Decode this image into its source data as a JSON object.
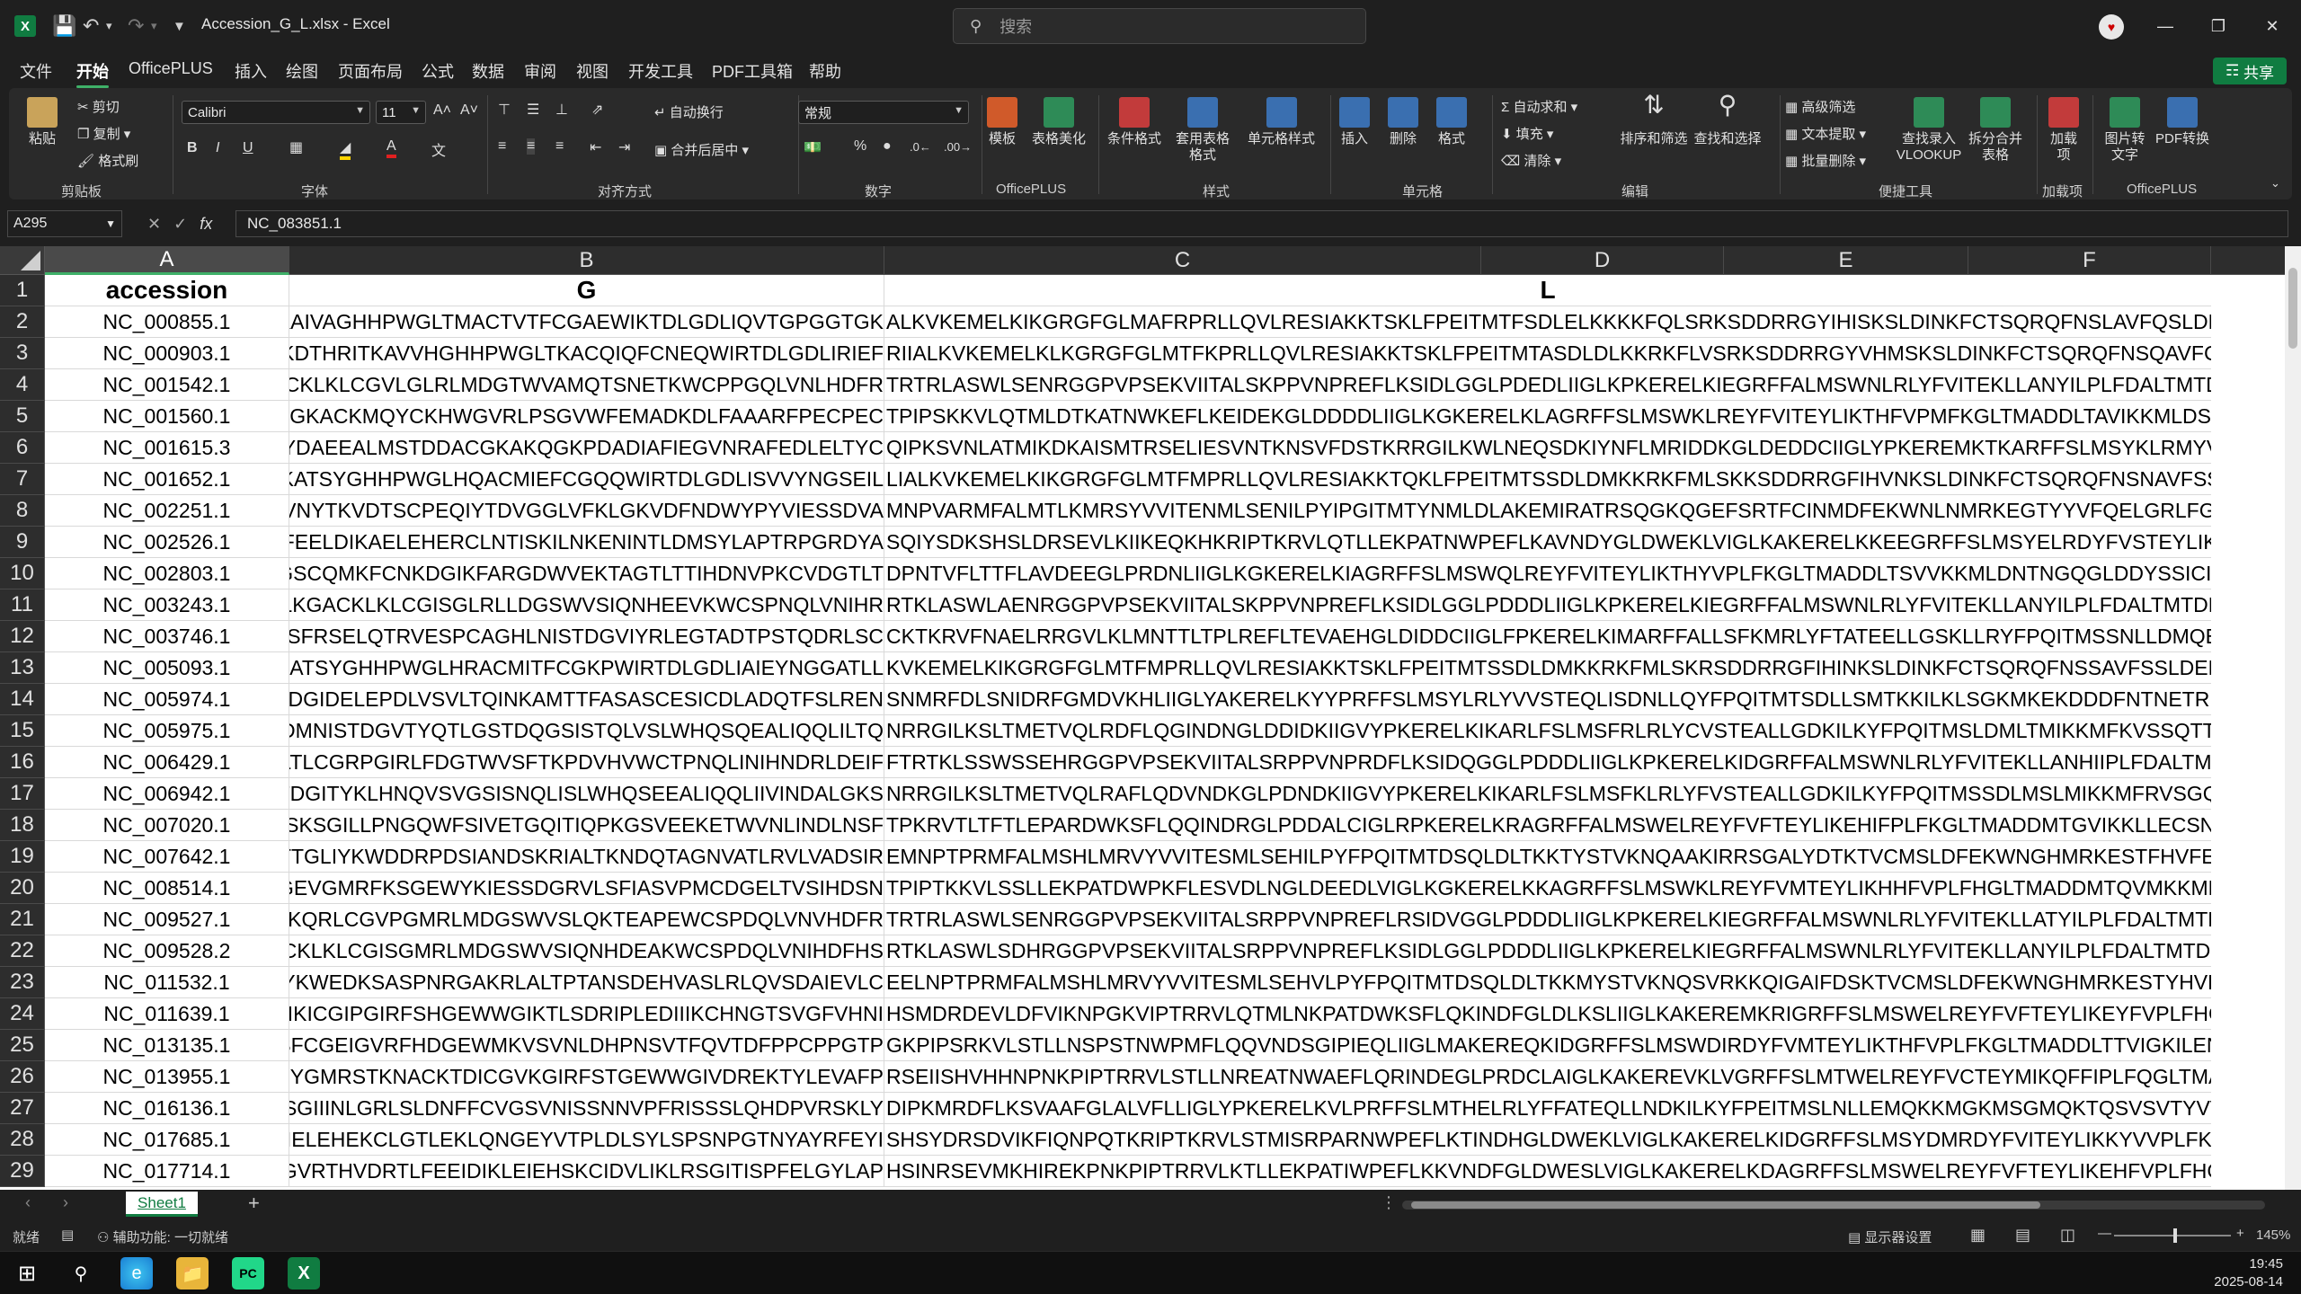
{
  "window": {
    "title": "Accession_G_L.xlsx - Excel"
  },
  "search": {
    "placeholder": "搜索"
  },
  "menu": {
    "tabs": [
      "文件",
      "开始",
      "OfficePLUS",
      "插入",
      "绘图",
      "页面布局",
      "公式",
      "数据",
      "审阅",
      "视图",
      "开发工具",
      "PDF工具箱",
      "帮助"
    ],
    "share": "共享"
  },
  "ribbon": {
    "clipboard": {
      "paste": "粘贴",
      "cut": "剪切",
      "copy": "复制",
      "format_painter": "格式刷",
      "label": "剪贴板"
    },
    "font": {
      "name": "Calibri",
      "size": "11",
      "label": "字体",
      "bold": "B",
      "italic": "I",
      "underline": "U"
    },
    "alignment": {
      "wrap": "自动换行",
      "merge": "合并后居中",
      "label": "对齐方式"
    },
    "number": {
      "format": "常规",
      "label": "数字"
    },
    "officeplus": {
      "template": "模板",
      "beautify": "表格美化",
      "label": "OfficePLUS"
    },
    "styles": {
      "conditional": "条件格式",
      "table_format": "套用表格格式",
      "cell_styles": "单元格样式",
      "label": "样式"
    },
    "cells": {
      "insert": "插入",
      "delete": "删除",
      "format": "格式",
      "label": "单元格"
    },
    "editing": {
      "autosum": "自动求和",
      "fill": "填充",
      "clear": "清除",
      "sort": "排序和筛选",
      "find": "查找和选择",
      "label": "编辑"
    },
    "tools": {
      "advanced_filter": "高级筛选",
      "text_extract": "文本提取",
      "batch_delete": "批量删除",
      "vlookup": "查找录入VLOOKUP",
      "split_merge": "拆分合并表格",
      "label": "便捷工具"
    },
    "addins": {
      "addin": "加载项",
      "label": "加载项"
    },
    "pdf": {
      "img_to_text": "图片转文字",
      "pdf_convert": "PDF转换",
      "label": "OfficePLUS"
    }
  },
  "formula_bar": {
    "name_box": "A295",
    "formula": "NC_083851.1"
  },
  "columns": [
    "A",
    "B",
    "C",
    "D",
    "E",
    "F"
  ],
  "header_row": {
    "A": "accession",
    "B": "G",
    "C": "L"
  },
  "rows": [
    {
      "n": "2",
      "acc": "NC_000855.1",
      "g": "VKAIVAGHHPWGLTMACTVTFCGAEWIKTDLGDLIQVTGPGGTGK",
      "l": "ALKVKEMELKIKGRGFGLMAFRPRLLQVLRESIAKKTSKLFPEITMTFSDLELKKKKFQLSRKSDDRRGYIHISKSLDINKFCTSQRQFNSLAVFQSLDELLGTDQLFTRVHL"
    },
    {
      "n": "3",
      "acc": "NC_000903.1",
      "g": "KKDTHRITKAVVHGHHPWGLTKACQIQFCNEQWIRTDLGDLIRIEF",
      "l": "RIIALKVKEMELKLKGRGFGLMTFKPRLLQVLRESIAKKTSKLFPEITMTASDLDLKKRKFLVSRKSDDRRGYVHMSKSLDINKFCTSQRQFNSQAVFCQLDELLGTGALF"
    },
    {
      "n": "4",
      "acc": "NC_001542.1",
      "g": "GACKLKLCGVLGLRLMDGTWVAMQTSNETKWCPPGQLVNLHDFR",
      "l": "TRTRLASWLSENRGGPVPSEKVIITALSKPPVNPREFLKSIDLGGLPDEDLIIGLKPKERELKIEGRFFALMSWNLRLYFVITEKLLANYILPLFDALTMTDNLNKVFKKLIDRV"
    },
    {
      "n": "5",
      "acc": "NC_001560.1",
      "g": "ETGGKACKMQYCKHWGVRLPSGVWFEMADKDLFAAARFPECPEC",
      "l": "TPIPSKKVLQTMLDTKATNWKEFLKEIDEKGLDDDDLIIGLKGKERELKLAGRFFSLMSWKLREYFVITEYLIKTHFVPMFKGLTMADDLTAVIKKMLDSSSGQGLSKYEAI"
    },
    {
      "n": "6",
      "acc": "NC_001615.3",
      "g": "FFYDAEEALMSTDDACGKAKQGKPDADIAFIEGVNRAFEDLELTYC",
      "l": "QIPKSVNLATMIKDKAISMTRSELIESVNTKNSVFDSTKRRGILKWLNEQSDKIYNFLMRIDDKGLDEDDCIIGLYPKEREMKTKARFFSLMSYKLRMYVTSTEELLGKYVT"
    },
    {
      "n": "7",
      "acc": "NC_001652.1",
      "g": "VKATSYGHHPWGLHQACMIEFCGQQWIRTDLGDLISVVYNGSEIL",
      "l": "LIALKVKEMELKIKGRGFGLMTFMPRLLQVLRESIAKKTQKLFPEITMTSSDLDMKKRKFMLSKKSDDRRGFIHVNKSLDINKFCTSQRQFNSNAVFSSLDELMGTPFLF"
    },
    {
      "n": "8",
      "acc": "NC_002251.1",
      "g": "GISLVNYTKVDTSCPEQIYTDVGGLVFKLGKVDFNDWYPYVIESSDVA",
      "l": "MNPVARMFALMTLKMRSYVVITENMLSENILPYIPGITMTYNMLDLAKEMIRATRSQGKQGEFSRTFCINMDFEKWNLNMRKEGTYYVFQELGRLFGLPTLYNKTYE"
    },
    {
      "n": "9",
      "acc": "NC_002526.1",
      "g": "RTEFEELDIKAELEHERCLNTISKILNKENINTLDMSYLAPTRPGRDYA",
      "l": "SQIYSDKSHSLDRSEVLKIIKEQKHKRIPTKRVLQTLLEKPATNWPEFLKAVNDYGLDWEKLVIGLKAKERELKKEEGRFFSLMSYELRDYFVSTEYLIKKYFVPLFEGLTMAD"
    },
    {
      "n": "10",
      "acc": "NC_002803.1",
      "g": "FGGSCQMKFCNKDGIKFARGDWVEKTAGTLTTIHDNVPKCVDGTLT",
      "l": "DPNTVFLTTFLAVDEEGLPRDNLIIGLKGKERELKIAGRFFSLMSWQLREYFVITEYLIKTHYVPLFKGLTMADDLTSVVKKMLDNTNGQGLDDYSSICIANHIDYEKWNNH"
    },
    {
      "n": "11",
      "acc": "NC_003243.1",
      "g": "VYKSLKGACKLKLCGISGLRLLDGSWVSIQNHEEVKWCSPNQLVNIHR",
      "l": "RTKLASWLAENRGGPVPSEKVIITALSKPPVNPREFLKSIDLGGLPDDDLIIGLKPKERELKIEGRFFALMSWNLRLYFVITEKLLANYILPLFDALTMTDNLNKVFKKLIDRV"
    },
    {
      "n": "12",
      "acc": "NC_003746.1",
      "g": "KKTIGVSFRSELQTRVESPCAGHLNISTDGVIYRLEGTADTPSTQDRLSC",
      "l": "CKTKRVFNAELRRGVLKLMNTTLTPLREFLTEVAEHGLDIDDCIIGLFPKERELKIMARFFALLSFKMRLYFTATEELLGSKLLRYFPQITMSSNLLDMQEKMSSMSRDLES"
    },
    {
      "n": "13",
      "acc": "NC_005093.1",
      "g": "VKATSYGHHPWGLHRACMITFCGKPWIRTDLGDLIAIEYNGGATLL",
      "l": "KVKEMELKIKGRGFGLMTFMPRLLQVLRESIAKKTSKLFPEITMTSSDLDMKKRKFMLSKRSDDRRGFIHINKSLDINKFCTSQRQFNSSAVFSSLDEMMGTFPLFSRVH"
    },
    {
      "n": "14",
      "acc": "NC_005974.1",
      "g": "MLQDGIDELEPDLVSVLTQINKAMTTFASASCESICDLADQTFSLREN",
      "l": "SNMRFDLSNIDRFGMDVKHLIIGLYAKERELKYYPRFFSLMSYLRLYVVSTEQLISDNLLQYFPQITMTSDLLSMTKKILKLSGKMKEKDDDFNTNETRKKEVSYSINIDFKRFS"
    },
    {
      "n": "15",
      "acc": "NC_005975.1",
      "g": "CVGDMNISTDGVTYQTLGSTDQGSISTQLVSLWHQSQEALIQQLILTQ",
      "l": "NRRGILKSLTMETVQLRDFLQGINDNGLDDIDKIIGVYPKERELKIKARLFSLMSFRLRLYCVSTEALLGDKILKYFPQITMSLDMLTMIKKMFKVSSQTTREDDSVTVIRKV"
    },
    {
      "n": "16",
      "acc": "NC_006429.1",
      "g": "ACKLTLCGRPGIRLFDGTWVSFTKPDVHVWCTPNQLINIHNDRLDEIF",
      "l": "FTRTKLSSWSSEHRGGPVPSEKVIITALSRPPVNPRDFLKSIDQGGLPDDDLIIGLKPKERELKIDGRFFALMSWNLRLYFVITEKLLANHIIPLFDALTMTDNLNKVFKKLIER"
    },
    {
      "n": "17",
      "acc": "NC_006942.1",
      "g": "NISTDGITYKLHNQVSVGSISNQLISLWHQSEEALIQQLIIVINDALGKS",
      "l": "NRRGILKSLTMETVQLRAFLQDVNDKGLPDNDKIIGVYPKERELKIKARLFSLMSFKLRLYFVSTEALLGDKILKYFPQITMSSDLMSLMIKKMFRVSGQTTRGDDSVTVIRK"
    },
    {
      "n": "18",
      "acc": "NC_007020.1",
      "g": "TLGSKSGILLPNGQWFSIVETGQITIQPKGSVEEKETWVNLINDLNSF",
      "l": "TPKRVTLTFTLEPARDWKSFLQQINDRGLPDDALCIGLRPKERELKRAGRFFALMSWELREYFVFTEYLIKEHIFPLFKGLTMADDMTGVIKKLLECSNGHGETDYSNITIE"
    },
    {
      "n": "19",
      "acc": "NC_007642.1",
      "g": "KSTTGLIYKWDDRPDSIANDSKRIALTKNDQTAGNVATLRVLVADSIR",
      "l": "EMNPTPRMFALMSHLMRVYVVITESMLSEHILPYFPQITMTDSQLDLTKKTYSTVKNQAAKIRRSGALYDTKTVCMSLDFEKWNGHMRKESTFHVFEALGDLFGMS"
    },
    {
      "n": "20",
      "acc": "NC_008514.1",
      "g": "ISMCGEVGMRFKSGEWYKIESSDGRVLSFIASVPMCDGELTVSIHDSN",
      "l": "TPIPTKKVLSSLLEKPATDWPKFLESVDLNGLDEEDLVIGLKGKERELKKAGRFFSLMSWKLREYFVMTEYLIKHHFVPLFHGLTMADDMTQVMKKMLDRSQGQGEF"
    },
    {
      "n": "21",
      "acc": "NC_009527.1",
      "g": "GACKQRLCGVPGMRLMDGSWVSLQKTEAPEWCSPDQLVNVHDFR",
      "l": "TRTRLASWLSENRGGPVPSEKVIITALSRPPVNPREFLRSIDVGGLPDDDLIIGLKPKERELKIEGRFFALMSWNLRLYFVITEKLLATYILPLFDALTMTDNLNKVFKKLIDRV"
    },
    {
      "n": "22",
      "acc": "NC_009528.2",
      "g": "GACKLKLCGISGMRLMDGSWVSIQNHDEAKWCSPDQLVNIHDFHS",
      "l": "RTKLASWLSDHRGGPVPSEKVIITALSRPPVNPREFLKSIDLGGLPDDDLIIGLKPKERELKIEGRFFALMSWNLRLYFVITEKLLANYILPLFDALTMTDNLNKVFKKLIDRV"
    },
    {
      "n": "23",
      "acc": "NC_011532.1",
      "g": "GLLYKWEDKSASPNRGAKRLALTPTANSDEHVASLRLQVSDAIEVLC",
      "l": "EELNPTPRMFALMSHLMRVYVVITESMLSEHVLPYFPQITMTDSQLDLTKKMYSTVKNQSVRKKQIGAIFDSKTVCMSLDFEKWNGHMRKESTYHVFEALGELFGMS"
    },
    {
      "n": "24",
      "acc": "NC_011639.1",
      "g": "ACIIKICGIPGIRFSHGEWWGIKTLSDRIPLEDIIIKCHNGTSVGFVHNI",
      "l": "HSMDRDEVLDFVIKNPGKVIPTRRVLQTMLNKPATDWKSFLQKINDFGLDLKSLIIGLKAKEREMKRIGRFFSLMSWELREYFVFTEYLIKEYFVPLFHGLTMADDLQSFT"
    },
    {
      "n": "25",
      "acc": "NC_013135.1",
      "g": "ACRISFCGEIGVRFHDGEWMKVSVNLDHPNSVTFQVTDFPPCPPGTP",
      "l": "GKPIPSRKVLSTLLNSPSTNWPMFLQQVNDSGIPIEQLIIGLMAKEREQKIDGRFFSLMSWDIRDYFVMTEYLIKTHFVPLFKGLTMADDLTTVIGKILENSRGQGEAD"
    },
    {
      "n": "26",
      "acc": "NC_013955.1",
      "g": "GSGYGMRSTKNACKTDICGVKGIRFSTGEWWGIVDREKTYLEVAFP",
      "l": "RSEIISHVHHNPNKPIPTRRVLSTLLNREATNWAEFLQRINDEGLPRDCLAIGLKAKEREVKLVGRFFSLMTWELREYFVCTEYMIKQFFIPLFQGLTMADDMQEVLKKLLD"
    },
    {
      "n": "27",
      "acc": "NC_016136.1",
      "g": "ERSGIIINLGRLSLDNFFCVGSVNISSNNVPFRISSSLQHDPVRSKLY",
      "l": "DIPKMRDFLKSVAAFGLALVFLLIGLYPKERELKVLPRFFSLMTHELRLYFFATEQLLNDKILKYFPEITMSLNLLEMQKKMGKMSGMQKTQSVSVTYVVNMDFVKWNQ"
    },
    {
      "n": "28",
      "acc": "NC_017685.1",
      "g": "DLEFEIELEHEKCLGTLEKLQNGEYVTPLDLSYLSPSNPGTNYAYRFEYI",
      "l": "SHSYDRSDVIKFIQNPQTKRIPTKRVLSTMISRPARNWPEFLKTINDHGLDWEKLVIGLKAKERELKIDGRFFSLMSYDMRDYFVITEYLIKKYVVPLFKGLTMADDQNT"
    },
    {
      "n": "29",
      "acc": "NC_017714.1",
      "g": "EETIGVRTHVDRTLFEEIDIKLEIEHSKCIDVLIKLRSGITISPFELGYLAP",
      "l": "HSINRSEVMKHIREKPNKPIPTRRVLKTLLEKPATIWPEFLKKVNDFGLDWESLVIGLKAKERELKDAGRFFSLMSWELREYFVFTEYLIKEHFVPLFHGLTMADDLQTVIKK"
    }
  ],
  "sheet": {
    "tab": "Sheet1",
    "add": "+"
  },
  "status": {
    "ready": "就绪",
    "accessibility": "辅助功能: 一切就绪",
    "display": "显示器设置",
    "zoom": "145%"
  },
  "taskbar": {
    "time": "19:45",
    "date": "2025-08-14"
  }
}
